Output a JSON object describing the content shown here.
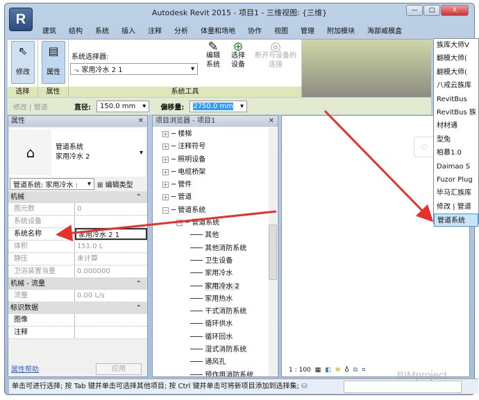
{
  "title": "Autodesk Revit 2015 -    项目1 - 三维视图: {三维}",
  "app_button": "R",
  "window_buttons": [
    "—",
    "□",
    "X"
  ],
  "tabs": [
    "建筑",
    "结构",
    "系统",
    "插入",
    "注释",
    "分析",
    "体量和场地",
    "协作",
    "视图",
    "管理",
    "附加模块",
    "海部威模盒"
  ],
  "ribbon": {
    "modify": "修改",
    "properties": "属性",
    "select_label": "选择",
    "props_label": "属性",
    "system_selector_label": "系统选择器:",
    "system_selector_value": "家用冷水 2 1",
    "edit_system": [
      "编辑",
      "系统"
    ],
    "select_equipment": [
      "选择",
      "设备"
    ],
    "disconnect": [
      "断开与设备的",
      "连接"
    ],
    "panel_system_tools": "系统工具"
  },
  "options_bar": {
    "context": "修改 | 管道",
    "diameter_label": "直径:",
    "diameter": "150.0 mm",
    "offset_label": "偏移量:",
    "offset": "2750.0 mm"
  },
  "properties": {
    "title": "属性",
    "type_family": "管道系统",
    "type_name": "家用冷水 2",
    "instance_selector": "管道系统: 家用冷水 :",
    "edit_type": "编辑类型",
    "groups": [
      {
        "name": "机械",
        "rows": [
          [
            "图元数",
            "0"
          ],
          [
            "系统设备",
            ""
          ],
          [
            "系统名称",
            "家用冷水 2 1"
          ],
          [
            "体积",
            "151.0 L"
          ],
          [
            "静压",
            "未计算"
          ],
          [
            "卫浴装置当量",
            "0.000000"
          ]
        ]
      },
      {
        "name": "机械 - 流量",
        "rows": [
          [
            "流量",
            "0.00 L/s"
          ]
        ]
      },
      {
        "name": "标识数据",
        "rows": [
          [
            "图像",
            ""
          ],
          [
            "注释",
            ""
          ]
        ]
      }
    ],
    "help": "属性帮助",
    "apply": "应用"
  },
  "browser": {
    "title": "项目浏览器 - 项目1",
    "items": [
      [
        "+",
        "楼梯",
        0
      ],
      [
        "+",
        "注释符号",
        0
      ],
      [
        "+",
        "照明设备",
        0
      ],
      [
        "+",
        "电缆桥架",
        0
      ],
      [
        "+",
        "管件",
        0
      ],
      [
        "+",
        "管道",
        0
      ],
      [
        "−",
        "管道系统",
        0
      ],
      [
        "−",
        "管道系统",
        1
      ],
      [
        "",
        "其他",
        2
      ],
      [
        "",
        "其他消防系统",
        2
      ],
      [
        "",
        "卫生设备",
        2
      ],
      [
        "",
        "家用冷水",
        2
      ],
      [
        "",
        "家用冷水 2",
        2
      ],
      [
        "",
        "家用热水",
        2
      ],
      [
        "",
        "干式消防系统",
        2
      ],
      [
        "",
        "循环供水",
        2
      ],
      [
        "",
        "循环回水",
        2
      ],
      [
        "",
        "湿式消防系统",
        2
      ],
      [
        "",
        "通风孔",
        2
      ],
      [
        "",
        "预作用消防系统",
        2
      ]
    ]
  },
  "menu": [
    "族库大师V",
    "翻模大师(",
    "翻模大师(",
    "八戒云族库",
    "RevitBus",
    "RevitBus 族",
    "材材通",
    "型兔",
    "柏慕1.0",
    "Daimao S",
    "Fuzor Plug",
    "毕马汇族库",
    "修改 | 管道",
    "管道系统"
  ],
  "view": {
    "scale": "1 : 100"
  },
  "status": "单击可进行选择; 按 Tab 键并单击可选择其他项目; 按 Ctrl 键并单击可将新项目添加到选择集;",
  "watermark": "BIMproject",
  "colors": {
    "arrow": "#e8302a",
    "highlight": "#3399ff"
  }
}
